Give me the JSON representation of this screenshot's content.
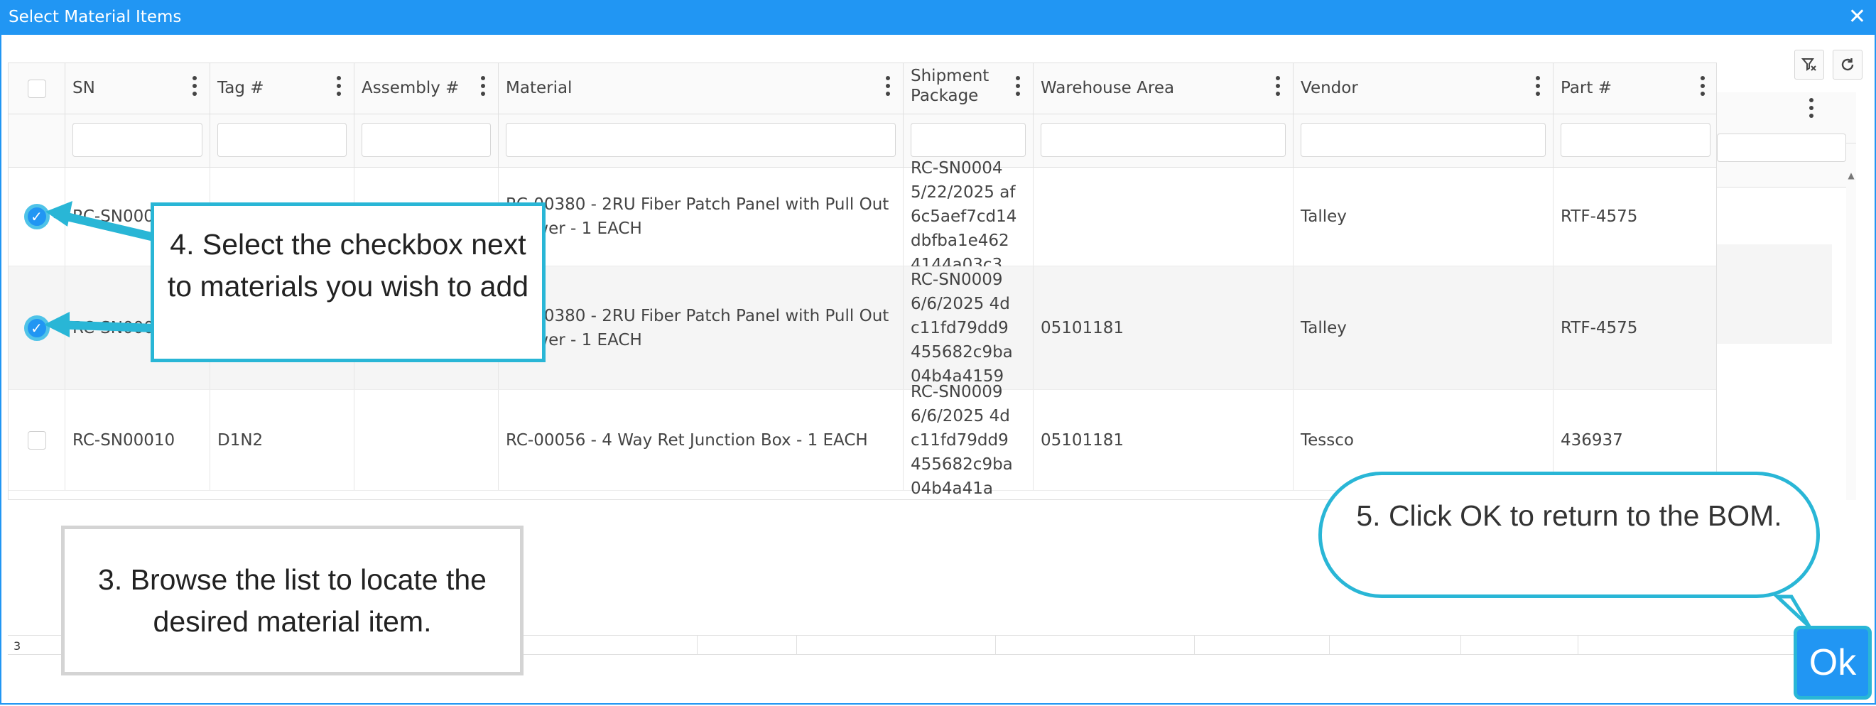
{
  "dialog": {
    "title": "Select Material Items",
    "close_glyph": "✕"
  },
  "toolbar": {
    "clear_filter_icon": "clear-filter-icon",
    "refresh_icon": "refresh-icon"
  },
  "columns": [
    {
      "label": ""
    },
    {
      "label": "SN"
    },
    {
      "label": "Tag #"
    },
    {
      "label": "Assembly #"
    },
    {
      "label": "Material"
    },
    {
      "label": "Shipment Package"
    },
    {
      "label": "Warehouse Area"
    },
    {
      "label": "Vendor"
    },
    {
      "label": "Part #"
    }
  ],
  "rows": [
    {
      "checked": true,
      "sn": "RC-SN0004",
      "tag": "",
      "assembly": "",
      "material": "RC-00380 - 2RU Fiber Patch Panel with Pull Out Drawer - 1 EACH",
      "shipment": "RC-SN0004 5/22/2025 af6c5aef7cd14dbfba1e4624144a03c3",
      "warehouse": "",
      "vendor": "Talley",
      "part": "RTF-4575"
    },
    {
      "checked": true,
      "sn": "RC-SN0009",
      "tag": "",
      "assembly": "",
      "material": "RC-00380 - 2RU Fiber Patch Panel with Pull Out Drawer - 1 EACH",
      "shipment": "RC-SN0009 6/6/2025 4dc11fd79dd9455682c9ba04b4a4159",
      "warehouse": "05101181",
      "vendor": "Talley",
      "part": "RTF-4575"
    },
    {
      "checked": false,
      "sn": "RC-SN00010",
      "tag": "D1N2",
      "assembly": "",
      "material": "RC-00056 - 4 Way Ret Junction Box - 1 EACH",
      "shipment": "RC-SN0009 6/6/2025 4dc11fd79dd9455682c9ba04b4a41a",
      "warehouse": "05101181",
      "vendor": "Tessco",
      "part": "436937"
    }
  ],
  "footer": {
    "count": "3"
  },
  "callouts": {
    "step4": "4. Select the checkbox next to materials you wish to add",
    "step3": "3. Browse the list to locate the desired material item.",
    "step5": "5. Click OK to return to the BOM."
  },
  "ok_button": {
    "label": "Ok"
  },
  "accent": "#2196f3",
  "callout_color": "#29b6d6"
}
